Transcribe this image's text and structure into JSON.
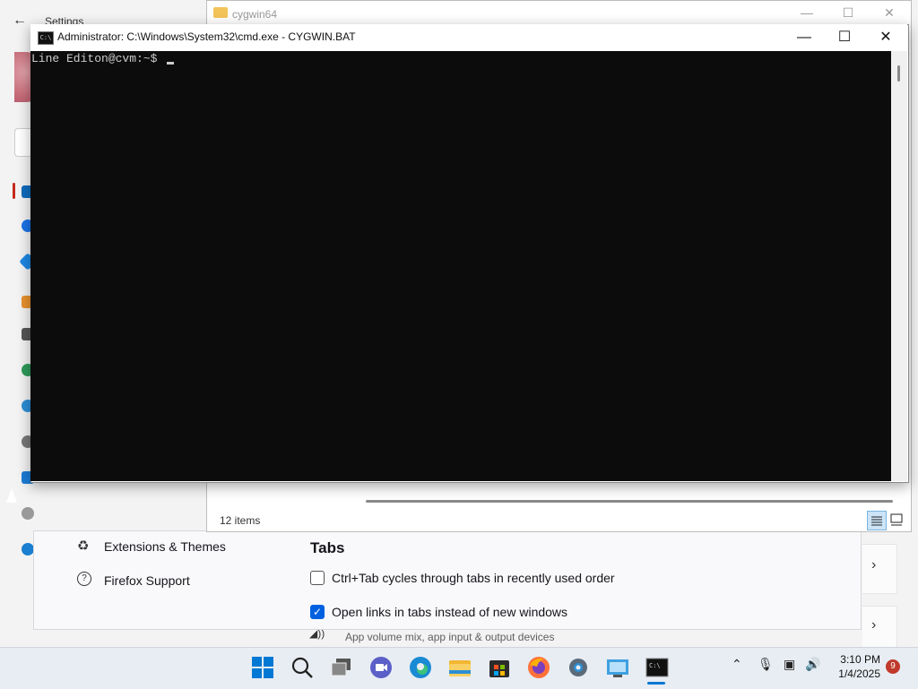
{
  "settings": {
    "title": "Settings",
    "sound_description": "App volume mix, app input & output devices"
  },
  "firefox": {
    "sidebar": [
      {
        "label": "Extensions & Themes",
        "icon": "puzzle-icon"
      },
      {
        "label": "Firefox Support",
        "icon": "help-circle-icon"
      }
    ],
    "tabs_heading": "Tabs",
    "options": [
      {
        "label": "Ctrl+Tab cycles through tabs in recently used order",
        "checked": false
      },
      {
        "label": "Open links in tabs instead of new windows",
        "checked": true
      }
    ]
  },
  "explorer": {
    "title": "cygwin64",
    "status": "12 items"
  },
  "cmd": {
    "title": "Administrator: C:\\Windows\\System32\\cmd.exe - CYGWIN.BAT",
    "icon_text": "C:\\",
    "prompt": "Line Editon@cvm:~$ "
  },
  "taskbar": {
    "apps": [
      "start-icon",
      "search-icon",
      "task-view-icon",
      "meet-icon",
      "edge-icon",
      "file-explorer-icon",
      "store-icon",
      "firefox-icon",
      "settings-gear-icon",
      "control-panel-icon",
      "cmd-icon"
    ],
    "time": "3:10 PM",
    "date": "1/4/2025",
    "notification_count": "9"
  },
  "colors": {
    "accent": "#0061e0",
    "console_bg": "#0c0c0c",
    "taskbar_bg": "#e8edf3"
  }
}
